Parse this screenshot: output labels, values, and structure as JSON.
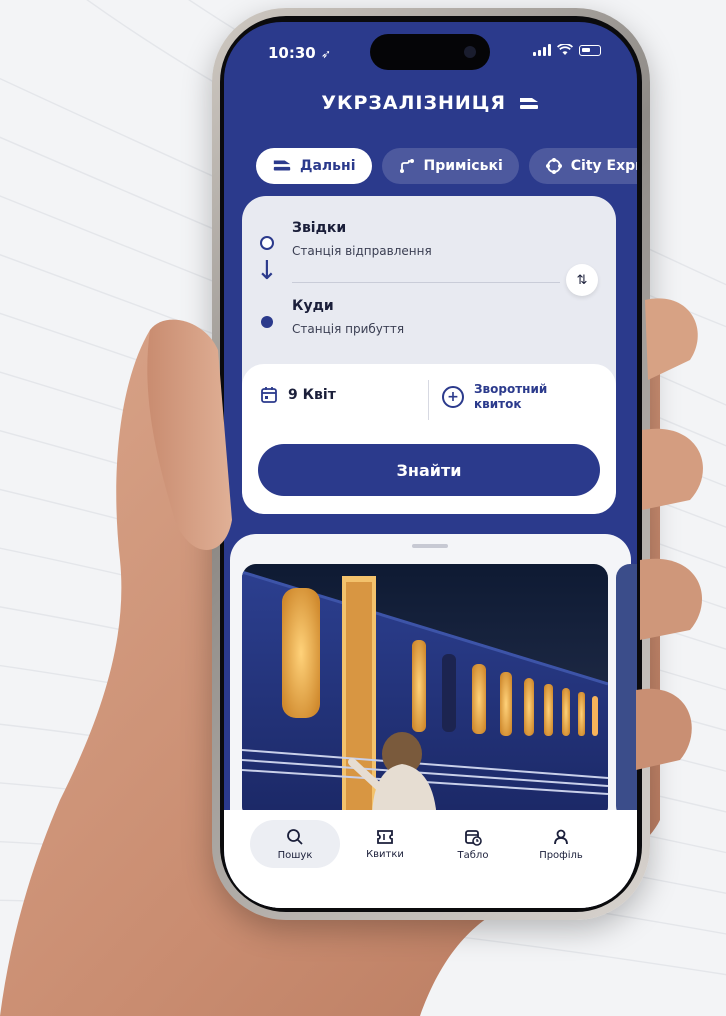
{
  "status_bar": {
    "time": "10:30"
  },
  "brand": {
    "name": "УКРЗАЛІЗНИЦЯ"
  },
  "tabs": [
    {
      "label": "Дальні",
      "icon": "train-icon",
      "active": true
    },
    {
      "label": "Приміські",
      "icon": "route-icon",
      "active": false
    },
    {
      "label": "City Expre",
      "icon": "city-express-icon",
      "active": false
    }
  ],
  "route": {
    "from_label": "Звідки",
    "from_placeholder": "Станція відправлення",
    "to_label": "Куди",
    "to_placeholder": "Станція прибуття"
  },
  "date": {
    "value": "9 Квіт"
  },
  "return_ticket": {
    "line1": "Зворотний",
    "line2": "квиток"
  },
  "find_button": {
    "label": "Знайти"
  },
  "bottom_nav": [
    {
      "label": "Пошук",
      "icon": "search-icon",
      "active": true
    },
    {
      "label": "Квитки",
      "icon": "ticket-icon",
      "active": false
    },
    {
      "label": "Табло",
      "icon": "schedule-board-icon",
      "active": false
    },
    {
      "label": "Профіль",
      "icon": "profile-icon",
      "active": false
    }
  ],
  "colors": {
    "primary": "#2b3a8c",
    "background": "#f3f4f6",
    "card": "#e8eaf1"
  }
}
